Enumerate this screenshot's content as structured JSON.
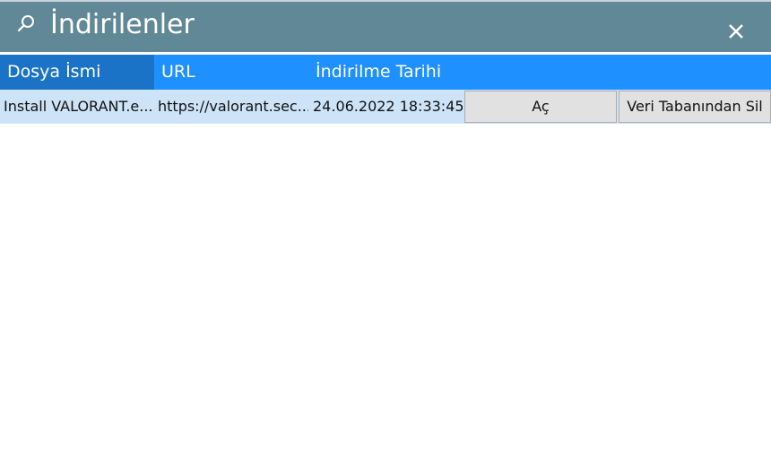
{
  "window": {
    "title": "İndirilenler",
    "icons": {
      "search": "search-icon",
      "close": "close-icon"
    }
  },
  "table": {
    "headers": [
      "Dosya İsmi",
      "URL",
      "İndirilme Tarihi"
    ],
    "rows": [
      {
        "file_name": "Install VALORANT.e...",
        "url": "https://valorant.sec...",
        "date": "24.06.2022 18:33:45...",
        "open_label": "Aç",
        "delete_label": "Veri Tabanından Sil"
      }
    ]
  },
  "colors": {
    "titlebar": "#608896",
    "header": "#1e90ff",
    "header_active": "#1b73c8",
    "row_selected": "#cde3f7"
  }
}
